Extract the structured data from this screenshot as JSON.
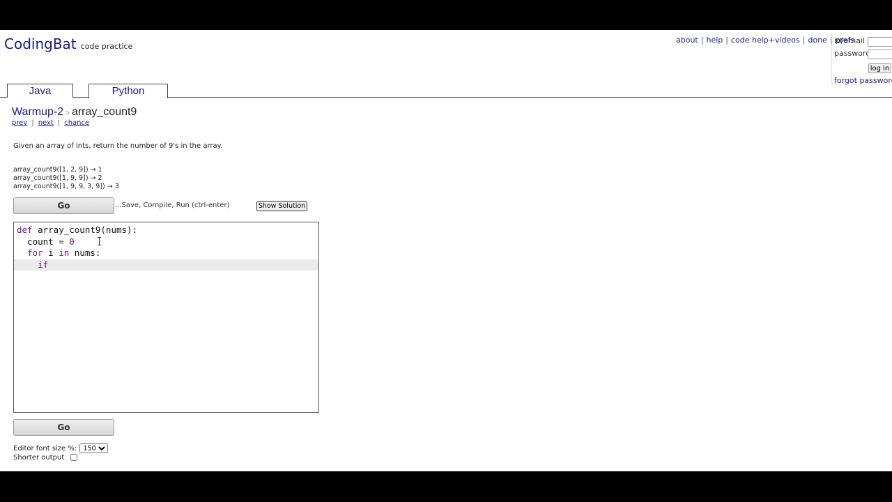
{
  "header": {
    "logo": "CodingBat",
    "tagline": "code practice",
    "links": [
      "about",
      "help",
      "code help+videos",
      "done",
      "prefs"
    ]
  },
  "login": {
    "id_label": "id/email",
    "password_label": "password",
    "button": "log in",
    "forgot": "forgot password",
    "forgot_sep": "|"
  },
  "tabs": [
    {
      "label": "Java",
      "active": false
    },
    {
      "label": "Python",
      "active": true
    }
  ],
  "breadcrumb": {
    "section": "Warmup-2",
    "separator": ">",
    "problem": "array_count9"
  },
  "nav": {
    "prev": "prev",
    "next": "next",
    "chance": "chance",
    "sep": "|"
  },
  "description": "Given an array of ints, return the number of 9's in the array.",
  "examples": [
    "array_count9([1, 2, 9]) → 1",
    "array_count9([1, 9, 9]) → 2",
    "array_count9([1, 9, 9, 3, 9]) → 3"
  ],
  "actions": {
    "go_label": "Go",
    "save_note": "...Save, Compile, Run (ctrl-enter)",
    "show_solution": "Show Solution"
  },
  "editor": {
    "lines": [
      {
        "parts": [
          {
            "t": "def",
            "kw": true
          },
          {
            "t": " array_count9(nums):"
          }
        ]
      },
      {
        "parts": [
          {
            "t": "  count = "
          },
          {
            "t": "0",
            "kw": true
          },
          {
            "t": " "
          }
        ]
      },
      {
        "parts": [
          {
            "t": "  "
          },
          {
            "t": "for",
            "kw": true
          },
          {
            "t": " i "
          },
          {
            "t": "in",
            "kw": true
          },
          {
            "t": " nums:"
          }
        ]
      },
      {
        "parts": [
          {
            "t": "    "
          },
          {
            "t": "if",
            "kw": true
          }
        ],
        "active": true
      }
    ]
  },
  "settings": {
    "font_size_label": "Editor font size %:",
    "font_size_value": "150",
    "shorter_output_label": "Shorter output",
    "shorter_output_checked": false
  },
  "colors": {
    "link": "#1a1a8c",
    "keyword": "#7a1080",
    "active_line": "#ebebeb"
  }
}
